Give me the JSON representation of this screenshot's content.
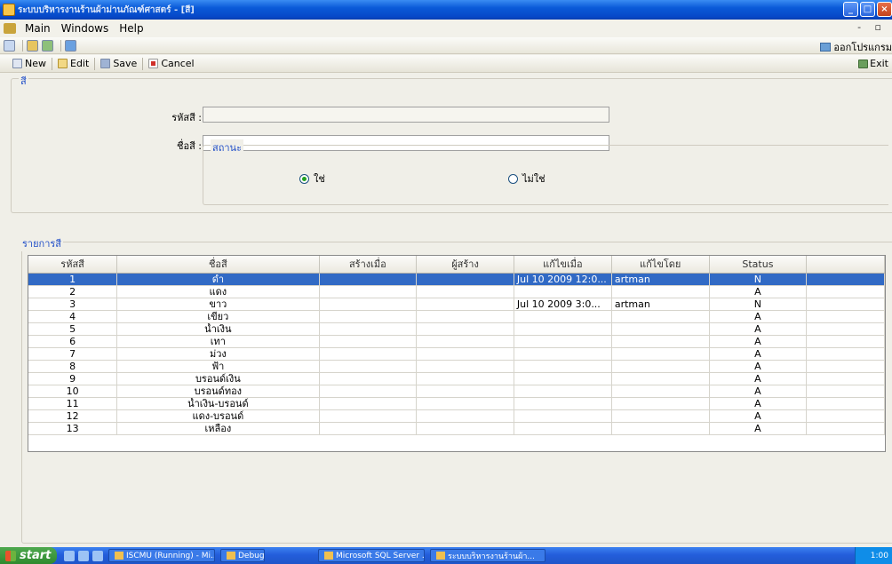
{
  "window": {
    "title": "ระบบบริหารงานร้านผ้าม่านภัณฑ์ศาสตร์ - [สี]"
  },
  "menu": {
    "items": [
      "Main",
      "Windows",
      "Help"
    ]
  },
  "quickbar": {
    "logout_label": "ออกโปรแกรม"
  },
  "toolbar": {
    "new_label": "New",
    "edit_label": "Edit",
    "save_label": "Save",
    "cancel_label": "Cancel",
    "exit_label": "Exit"
  },
  "form": {
    "group_title": "สี",
    "code_label": "รหัสสี :",
    "code_value": "",
    "name_label": "ชื่อสี :",
    "name_value": "",
    "status_group_title": "สถานะ",
    "status_options": [
      "ใช่",
      "ไม่ใช่"
    ],
    "status_selected": 0
  },
  "list": {
    "group_title": "รายการสี",
    "columns": [
      "รหัสสี",
      "ชื่อสี",
      "สร้างเมื่อ",
      "ผู้สร้าง",
      "แก้ไขเมื่อ",
      "แก้ไขโดย",
      "Status"
    ],
    "selected_index": 0,
    "rows": [
      [
        "1",
        "ดำ",
        "",
        "",
        "Jul 10 2009 12:0...",
        "artman",
        "N"
      ],
      [
        "2",
        "แดง",
        "",
        "",
        "",
        "",
        "A"
      ],
      [
        "3",
        "ขาว",
        "",
        "",
        "Jul 10 2009 3:0...",
        "artman",
        "N"
      ],
      [
        "4",
        "เขียว",
        "",
        "",
        "",
        "",
        "A"
      ],
      [
        "5",
        "น้ำเงิน",
        "",
        "",
        "",
        "",
        "A"
      ],
      [
        "6",
        "เทา",
        "",
        "",
        "",
        "",
        "A"
      ],
      [
        "7",
        "ม่วง",
        "",
        "",
        "",
        "",
        "A"
      ],
      [
        "8",
        "ฟ้า",
        "",
        "",
        "",
        "",
        "A"
      ],
      [
        "9",
        "บรอนด์เงิน",
        "",
        "",
        "",
        "",
        "A"
      ],
      [
        "10",
        "บรอนด์ทอง",
        "",
        "",
        "",
        "",
        "A"
      ],
      [
        "11",
        "น้ำเงิน-บรอนด์",
        "",
        "",
        "",
        "",
        "A"
      ],
      [
        "12",
        "แดง-บรอนด์",
        "",
        "",
        "",
        "",
        "A"
      ],
      [
        "13",
        "เหลือง",
        "",
        "",
        "",
        "",
        "A"
      ]
    ]
  },
  "taskbar": {
    "start_label": "start",
    "tasks": [
      "ISCMU (Running) - Mi...",
      "Debug",
      "Microsoft SQL Server ...",
      "ระบบบริหารงานร้านผ้า..."
    ],
    "clock": "1:00"
  }
}
